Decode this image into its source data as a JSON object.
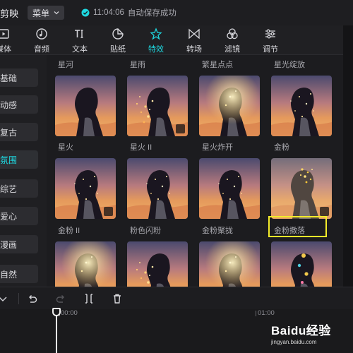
{
  "titlebar": {
    "app_title": "剪映",
    "menu_label": "菜单",
    "save_time": "11:04:06",
    "save_text": "自动保存成功"
  },
  "toolbar": {
    "tabs": [
      {
        "label": "媒体",
        "icon": "media-icon"
      },
      {
        "label": "音频",
        "icon": "audio-icon"
      },
      {
        "label": "文本",
        "icon": "text-icon"
      },
      {
        "label": "贴纸",
        "icon": "sticker-icon"
      },
      {
        "label": "特效",
        "icon": "effects-icon",
        "active": true
      },
      {
        "label": "转场",
        "icon": "transition-icon"
      },
      {
        "label": "滤镜",
        "icon": "filter-icon"
      },
      {
        "label": "调节",
        "icon": "adjust-icon"
      }
    ]
  },
  "sidebar": {
    "items": [
      {
        "label": "基础"
      },
      {
        "label": "动感"
      },
      {
        "label": "复古"
      },
      {
        "label": "氛围",
        "active": true
      },
      {
        "label": "综艺"
      },
      {
        "label": "爱心"
      },
      {
        "label": "漫画"
      },
      {
        "label": "自然"
      }
    ]
  },
  "effects": {
    "top_row_labels": [
      "星河",
      "星雨",
      "繁星点点",
      "星光绽放"
    ],
    "rows": [
      [
        {
          "label": "星火",
          "download": false
        },
        {
          "label": "星火 II",
          "download": true
        },
        {
          "label": "星火炸开",
          "download": false
        },
        {
          "label": "金粉",
          "download": false
        }
      ],
      [
        {
          "label": "金粉 II",
          "download": true
        },
        {
          "label": "粉色闪粉",
          "download": false
        },
        {
          "label": "金粉聚拢",
          "download": false
        },
        {
          "label": "金粉撒落",
          "download": true,
          "highlighted": true
        }
      ]
    ]
  },
  "timeline": {
    "time_start": "00:00",
    "time_mark": "01:00"
  },
  "watermark": {
    "main": "Baidu经验",
    "sub": "jingyan.baidu.com"
  },
  "colors": {
    "accent": "#1ed8e0",
    "highlight": "#f4ec2a",
    "background": "#1a1a1c"
  }
}
